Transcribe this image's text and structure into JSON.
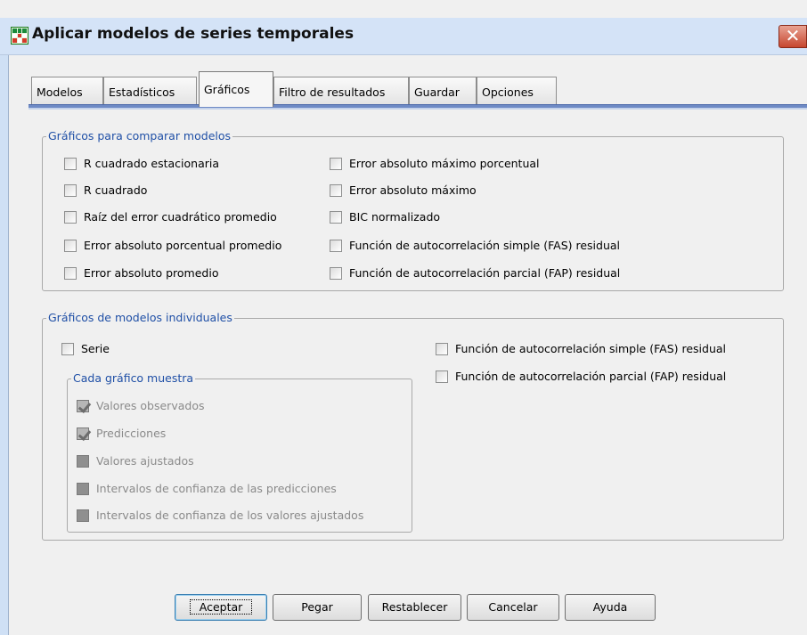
{
  "window": {
    "title": "Aplicar modelos de series temporales",
    "close_glyph": "✕"
  },
  "tabs": [
    {
      "label": "Modelos",
      "active": false
    },
    {
      "label": "Estadísticos",
      "active": false
    },
    {
      "label": "Gráficos",
      "active": true
    },
    {
      "label": "Filtro de resultados",
      "active": false
    },
    {
      "label": "Guardar",
      "active": false
    },
    {
      "label": "Opciones",
      "active": false
    }
  ],
  "compare_group": {
    "title": "Gráficos para comparar modelos",
    "left": [
      {
        "label": "R cuadrado estacionaria",
        "checked": false
      },
      {
        "label": "R cuadrado",
        "checked": false
      },
      {
        "label": "Raíz del error cuadrático promedio",
        "checked": false
      },
      {
        "label": "Error absoluto porcentual promedio",
        "checked": false
      },
      {
        "label": "Error absoluto promedio",
        "checked": false
      }
    ],
    "right": [
      {
        "label": "Error absoluto máximo porcentual",
        "checked": false
      },
      {
        "label": "Error absoluto máximo",
        "checked": false
      },
      {
        "label": "BIC normalizado",
        "checked": false
      },
      {
        "label": "Función de autocorrelación simple (FAS) residual",
        "checked": false
      },
      {
        "label": "Función de autocorrelación parcial (FAP) residual",
        "checked": false
      }
    ]
  },
  "individual_group": {
    "title": "Gráficos de modelos individuales",
    "serie": {
      "label": "Serie",
      "checked": false
    },
    "right": [
      {
        "label": "Función de autocorrelación simple (FAS) residual",
        "checked": false
      },
      {
        "label": "Función de autocorrelación parcial (FAP) residual",
        "checked": false
      }
    ],
    "sub_group": {
      "title": "Cada gráfico muestra",
      "items": [
        {
          "label": "Valores observados",
          "checked": true,
          "enabled": false
        },
        {
          "label": "Predicciones",
          "checked": true,
          "enabled": false
        },
        {
          "label": "Valores ajustados",
          "checked": false,
          "enabled": false
        },
        {
          "label": "Intervalos de confianza de las predicciones",
          "checked": false,
          "enabled": false
        },
        {
          "label": "Intervalos de confianza de los valores ajustados",
          "checked": false,
          "enabled": false
        }
      ]
    }
  },
  "buttons": {
    "accept": "Aceptar",
    "paste": "Pegar",
    "reset": "Restablecer",
    "cancel": "Cancelar",
    "help": "Ayuda"
  }
}
